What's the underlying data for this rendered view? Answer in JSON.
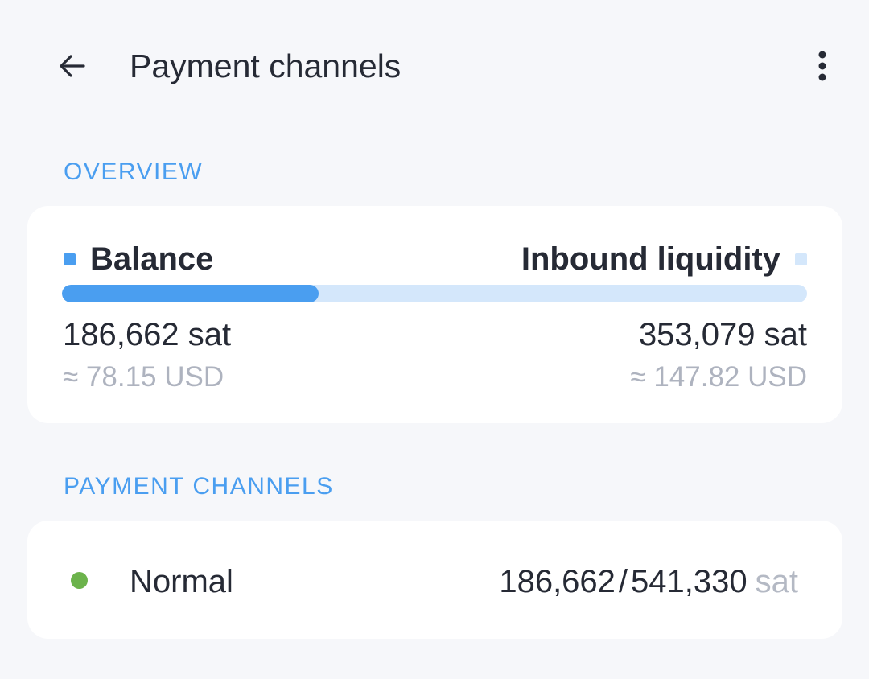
{
  "header": {
    "title": "Payment channels",
    "back_icon": "arrow-left-icon",
    "menu_icon": "more-vertical-icon"
  },
  "overview": {
    "section_label": "OVERVIEW",
    "balance_label": "Balance",
    "inbound_label": "Inbound liquidity",
    "balance_amount": "186,662 sat",
    "inbound_amount": "353,079 sat",
    "balance_fiat": "≈ 78.15 USD",
    "inbound_fiat": "≈ 147.82 USD",
    "balance_fraction": 0.345,
    "colors": {
      "balance": "#4a9ef0",
      "inbound": "#d4e7fb"
    }
  },
  "channels": {
    "section_label": "PAYMENT CHANNELS",
    "items": [
      {
        "name": "Normal",
        "balance": "186,662",
        "separator": "/",
        "capacity": "541,330",
        "unit": "sat",
        "status_color": "#6cb34c"
      }
    ]
  },
  "accent_color": "#4a9ef0"
}
